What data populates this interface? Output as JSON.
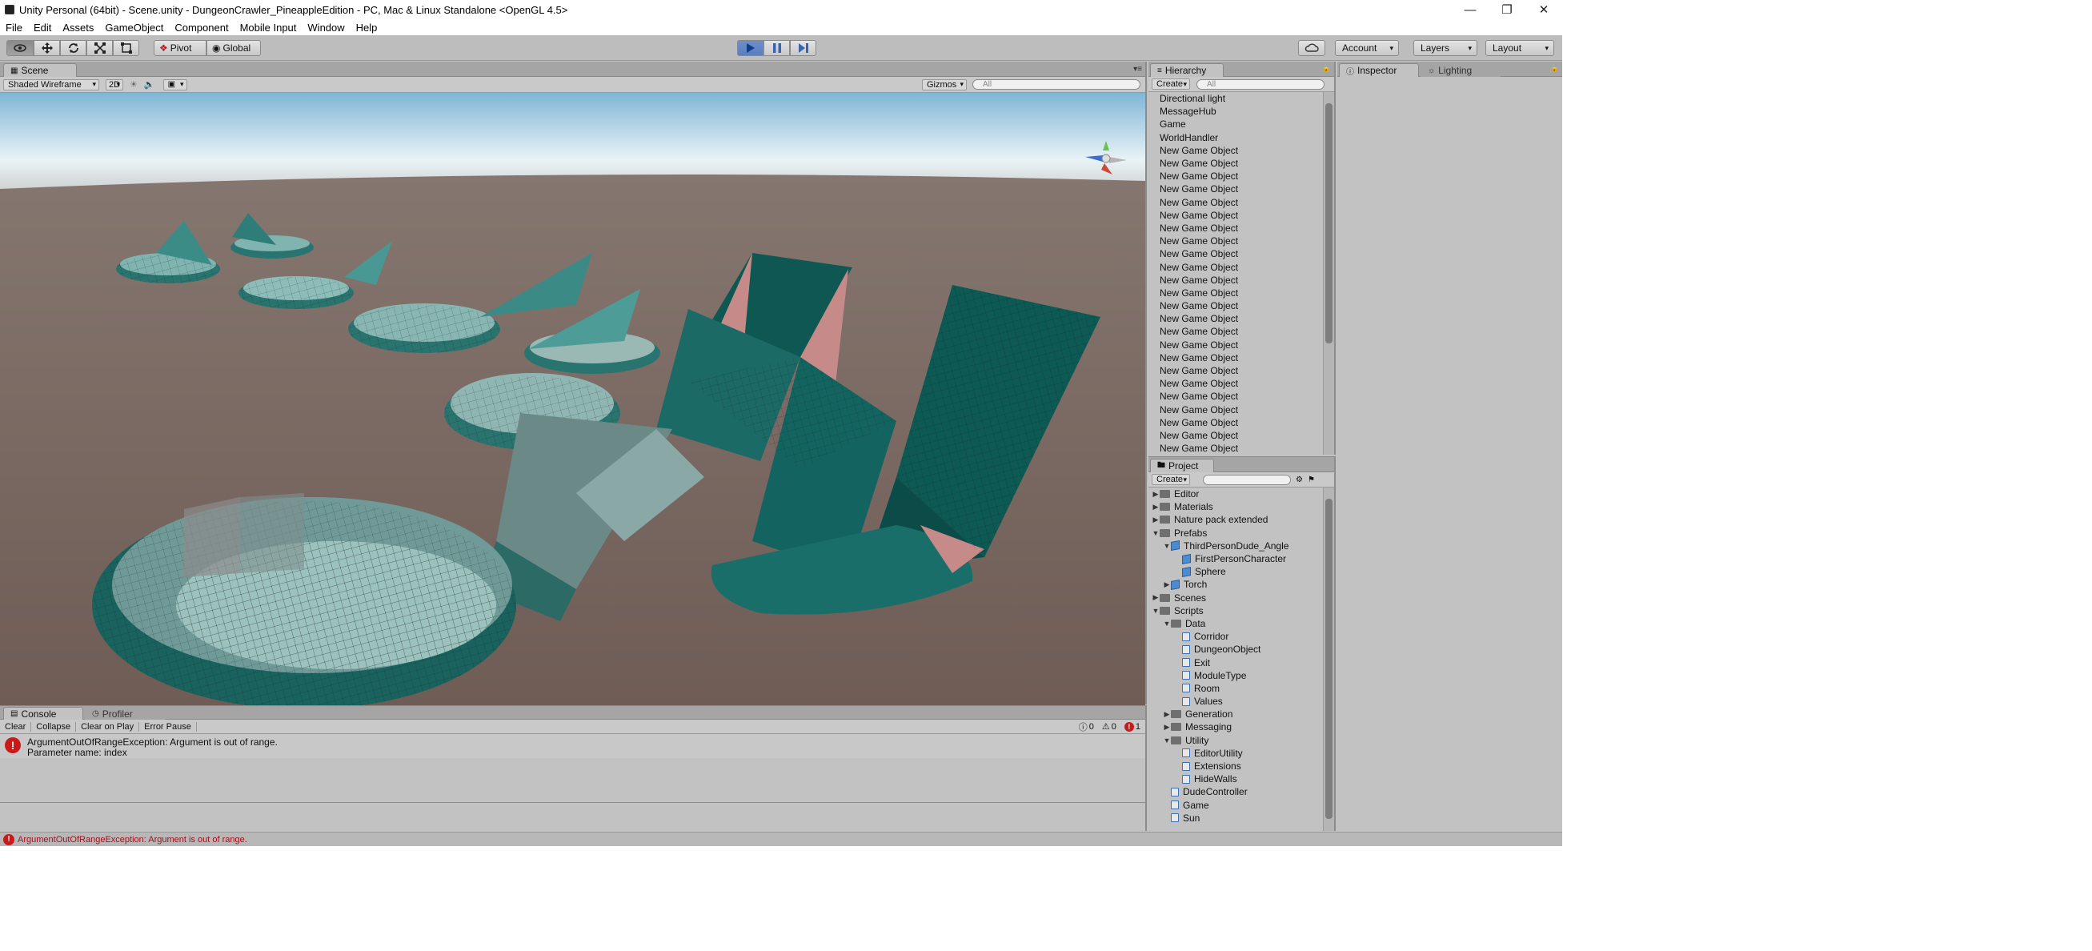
{
  "window": {
    "title": "Unity Personal (64bit) - Scene.unity - DungeonCrawler_PineappleEdition - PC, Mac & Linux Standalone <OpenGL 4.5>",
    "minimize": "—",
    "restore": "❐",
    "close": "✕"
  },
  "menu": [
    "File",
    "Edit",
    "Assets",
    "GameObject",
    "Component",
    "Mobile Input",
    "Window",
    "Help"
  ],
  "toolbar": {
    "pivot": "Pivot",
    "global": "Global",
    "account": "Account",
    "layers": "Layers",
    "layout": "Layout"
  },
  "scene": {
    "tab": "Scene",
    "shading": "Shaded Wireframe",
    "mode2d": "2D",
    "gizmos": "Gizmos",
    "search_placeholder": "All"
  },
  "hierarchy": {
    "tab": "Hierarchy",
    "create": "Create",
    "search_placeholder": "All",
    "items": [
      "Directional light",
      "MessageHub",
      "Game",
      "WorldHandler",
      "New Game Object",
      "New Game Object",
      "New Game Object",
      "New Game Object",
      "New Game Object",
      "New Game Object",
      "New Game Object",
      "New Game Object",
      "New Game Object",
      "New Game Object",
      "New Game Object",
      "New Game Object",
      "New Game Object",
      "New Game Object",
      "New Game Object",
      "New Game Object",
      "New Game Object",
      "New Game Object",
      "New Game Object",
      "New Game Object",
      "New Game Object",
      "New Game Object",
      "New Game Object",
      "New Game Object"
    ]
  },
  "project": {
    "tab": "Project",
    "create": "Create",
    "tree": [
      {
        "label": "Editor",
        "indent": 0,
        "kind": "folder",
        "arrow": "closed"
      },
      {
        "label": "Materials",
        "indent": 0,
        "kind": "folder",
        "arrow": "closed"
      },
      {
        "label": "Nature pack extended",
        "indent": 0,
        "kind": "folder",
        "arrow": "closed"
      },
      {
        "label": "Prefabs",
        "indent": 0,
        "kind": "folder",
        "arrow": "open"
      },
      {
        "label": "ThirdPersonDude_Angle",
        "indent": 1,
        "kind": "prefab",
        "arrow": "open"
      },
      {
        "label": "FirstPersonCharacter",
        "indent": 2,
        "kind": "prefab",
        "arrow": "none"
      },
      {
        "label": "Sphere",
        "indent": 2,
        "kind": "prefab",
        "arrow": "none"
      },
      {
        "label": "Torch",
        "indent": 1,
        "kind": "prefab",
        "arrow": "closed"
      },
      {
        "label": "Scenes",
        "indent": 0,
        "kind": "folder",
        "arrow": "closed"
      },
      {
        "label": "Scripts",
        "indent": 0,
        "kind": "folder",
        "arrow": "open"
      },
      {
        "label": "Data",
        "indent": 1,
        "kind": "folder",
        "arrow": "open"
      },
      {
        "label": "Corridor",
        "indent": 2,
        "kind": "script",
        "arrow": "none"
      },
      {
        "label": "DungeonObject",
        "indent": 2,
        "kind": "script",
        "arrow": "none"
      },
      {
        "label": "Exit",
        "indent": 2,
        "kind": "script",
        "arrow": "none"
      },
      {
        "label": "ModuleType",
        "indent": 2,
        "kind": "script",
        "arrow": "none"
      },
      {
        "label": "Room",
        "indent": 2,
        "kind": "script",
        "arrow": "none"
      },
      {
        "label": "Values",
        "indent": 2,
        "kind": "script",
        "arrow": "none"
      },
      {
        "label": "Generation",
        "indent": 1,
        "kind": "folder",
        "arrow": "closed"
      },
      {
        "label": "Messaging",
        "indent": 1,
        "kind": "folder",
        "arrow": "closed"
      },
      {
        "label": "Utility",
        "indent": 1,
        "kind": "folder",
        "arrow": "open"
      },
      {
        "label": "EditorUtility",
        "indent": 2,
        "kind": "script",
        "arrow": "none"
      },
      {
        "label": "Extensions",
        "indent": 2,
        "kind": "script",
        "arrow": "none"
      },
      {
        "label": "HideWalls",
        "indent": 2,
        "kind": "script",
        "arrow": "none"
      },
      {
        "label": "DudeController",
        "indent": 1,
        "kind": "script",
        "arrow": "none"
      },
      {
        "label": "Game",
        "indent": 1,
        "kind": "script",
        "arrow": "none"
      },
      {
        "label": "Sun",
        "indent": 1,
        "kind": "script",
        "arrow": "none"
      }
    ]
  },
  "inspector": {
    "tab": "Inspector",
    "lighting_tab": "Lighting"
  },
  "console": {
    "tab": "Console",
    "profiler_tab": "Profiler",
    "clear": "Clear",
    "collapse": "Collapse",
    "clear_on_play": "Clear on Play",
    "error_pause": "Error Pause",
    "log_count": "0",
    "warn_count": "0",
    "error_count": "1",
    "message_line1": "ArgumentOutOfRangeException: Argument is out of range.",
    "message_line2": "Parameter name: index",
    "error_glyph": "!"
  },
  "status": {
    "message": "ArgumentOutOfRangeException: Argument is out of range."
  },
  "colors": {
    "accent_play": "#5a7fbf",
    "teal_mesh": "#1c6a66",
    "pink_mesh": "#c68b88",
    "error_red": "#c91a1a"
  }
}
